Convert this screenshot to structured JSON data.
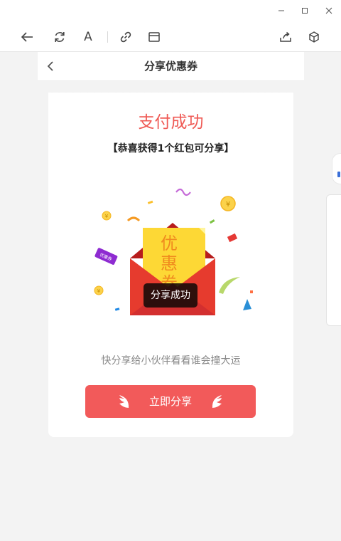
{
  "window": {
    "minimize_icon": "minimize-icon",
    "maximize_icon": "maximize-icon",
    "close_icon": "close-icon"
  },
  "toolbar": {
    "icons": [
      "back-arrow-icon",
      "refresh-icon",
      "font-icon",
      "link-icon",
      "window-icon",
      "share-icon",
      "cube-icon"
    ],
    "font_label": "A"
  },
  "page": {
    "title": "分享优惠券",
    "back_icon": "chevron-left-icon"
  },
  "card": {
    "success_title": "支付成功",
    "congrats": "【恭喜获得1个红包可分享】",
    "coupon_text": [
      "优",
      "惠",
      "券"
    ],
    "toast": "分享成功",
    "hint": "快分享给小伙伴看看谁会撞大运",
    "share_button": "立即分享",
    "coin_symbol": "¥",
    "ribbon_text": "优惠券"
  },
  "colors": {
    "accent_red": "#f25a5a",
    "title_red": "#ef5a55",
    "envelope_red": "#e63b2e",
    "coupon_yellow": "#fdd835"
  }
}
